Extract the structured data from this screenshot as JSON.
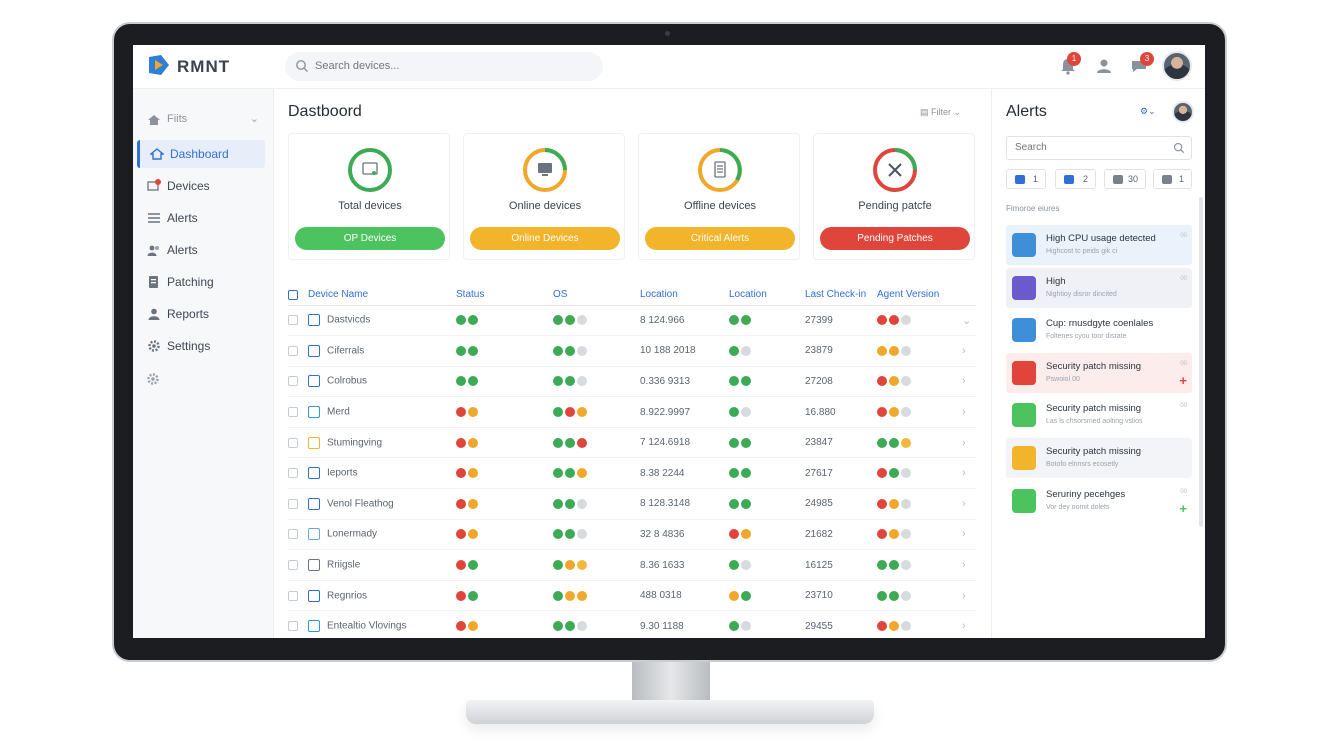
{
  "app": {
    "brand": "RMNT",
    "search_placeholder": "Search devices..."
  },
  "topbar": {
    "notifications_count": "1",
    "messages_count": "3"
  },
  "sidebar": {
    "filter_label": "Fiits",
    "items": [
      {
        "label": "Dashboard",
        "icon": "home-icon"
      },
      {
        "label": "Devices",
        "icon": "devices-icon"
      },
      {
        "label": "Alerts",
        "icon": "list-icon"
      },
      {
        "label": "Alerts",
        "icon": "users-icon"
      },
      {
        "label": "Patching",
        "icon": "patch-icon"
      },
      {
        "label": "Reports",
        "icon": "person-icon"
      },
      {
        "label": "Settings",
        "icon": "gear-icon"
      }
    ]
  },
  "main": {
    "title": "Dastboord",
    "filter_label": "Filter",
    "cards": [
      {
        "label": "Total devices",
        "button": "OP Devices",
        "color": "#4cc35f",
        "ring": "#3daa55",
        "icon": "monitor-icon"
      },
      {
        "label": "Online devices",
        "button": "Online Devices",
        "color": "#f2b42a",
        "ring": "#f0a72a",
        "icon": "monitor-icon"
      },
      {
        "label": "Offline devices",
        "button": "Critical Alerts",
        "color": "#f2b42a",
        "ring": "#f0a72a",
        "icon": "server-icon"
      },
      {
        "label": "Pending patcfe",
        "button": "Pending Patches",
        "color": "#e0453b",
        "ring": "#e0453b",
        "icon": "wrench-icon"
      }
    ],
    "table": {
      "headers": [
        "Device Name",
        "Status",
        "OS",
        "Location",
        "Location",
        "Last Check-in",
        "Agent Version"
      ],
      "rows": [
        {
          "name": "Dastvicds",
          "status": [
            "g",
            "g"
          ],
          "os": [
            "g",
            "g",
            "x"
          ],
          "location": "8 124.966",
          "loc2": [
            "g",
            "g"
          ],
          "checkin": "27399",
          "agent": [
            "r",
            "r",
            "x"
          ],
          "chevron": "⌄"
        },
        {
          "name": "Ciferrals",
          "status": [
            "g",
            "g"
          ],
          "os": [
            "g",
            "g",
            "x"
          ],
          "location": "10 188 2018",
          "loc2": [
            "g",
            "x"
          ],
          "checkin": "23879",
          "agent": [
            "o",
            "o",
            "x"
          ],
          "chevron": "›"
        },
        {
          "name": "Colrobus",
          "status": [
            "g",
            "g"
          ],
          "os": [
            "g",
            "g",
            "x"
          ],
          "location": "0.336 9313",
          "loc2": [
            "g",
            "g"
          ],
          "checkin": "27208",
          "agent": [
            "r",
            "o",
            "x"
          ],
          "chevron": "›"
        },
        {
          "name": "Merd",
          "status": [
            "r",
            "o"
          ],
          "os": [
            "g",
            "r",
            "o"
          ],
          "location": "8.922.9997",
          "loc2": [
            "g",
            "x"
          ],
          "checkin": "16.880",
          "agent": [
            "r",
            "o",
            "x"
          ],
          "chevron": "›"
        },
        {
          "name": "Stumingving",
          "status": [
            "r",
            "o"
          ],
          "os": [
            "g",
            "g",
            "r"
          ],
          "location": "7 124.6918",
          "loc2": [
            "g",
            "g"
          ],
          "checkin": "23847",
          "agent": [
            "g",
            "g",
            "y"
          ],
          "chevron": "›"
        },
        {
          "name": "Ieports",
          "status": [
            "r",
            "o"
          ],
          "os": [
            "g",
            "g",
            "o"
          ],
          "location": "8.38 2244",
          "loc2": [
            "g",
            "g"
          ],
          "checkin": "27617",
          "agent": [
            "r",
            "g",
            "x"
          ],
          "chevron": "›"
        },
        {
          "name": "Venol Fleathog",
          "status": [
            "r",
            "o"
          ],
          "os": [
            "g",
            "g",
            "x"
          ],
          "location": "8 128.3148",
          "loc2": [
            "g",
            "g"
          ],
          "checkin": "24985",
          "agent": [
            "r",
            "o",
            "x"
          ],
          "chevron": "›"
        },
        {
          "name": "Lonermady",
          "status": [
            "r",
            "o"
          ],
          "os": [
            "g",
            "g",
            "x"
          ],
          "location": "32 8 4836",
          "loc2": [
            "r",
            "o"
          ],
          "checkin": "21682",
          "agent": [
            "r",
            "o",
            "x"
          ],
          "chevron": "›"
        },
        {
          "name": "Rriigsle",
          "status": [
            "r",
            "g"
          ],
          "os": [
            "g",
            "o",
            "y"
          ],
          "location": "8.36 1633",
          "loc2": [
            "g",
            "x"
          ],
          "checkin": "16125",
          "agent": [
            "g",
            "g",
            "x"
          ],
          "chevron": "›"
        },
        {
          "name": "Regnrios",
          "status": [
            "r",
            "g"
          ],
          "os": [
            "g",
            "o",
            "o"
          ],
          "location": "488 0318",
          "loc2": [
            "o",
            "g"
          ],
          "checkin": "23710",
          "agent": [
            "g",
            "g",
            "x"
          ],
          "chevron": "›"
        },
        {
          "name": "Entealtio Vlovings",
          "status": [
            "r",
            "o"
          ],
          "os": [
            "g",
            "g",
            "x"
          ],
          "location": "9.30 1188",
          "loc2": [
            "g",
            "x"
          ],
          "checkin": "29455",
          "agent": [
            "r",
            "o",
            "x"
          ],
          "chevron": "›"
        }
      ]
    }
  },
  "alerts": {
    "title": "Alerts",
    "search_placeholder": "Search",
    "chips": [
      {
        "label": "1",
        "icon": "info-icon",
        "color": "#2f6fd6"
      },
      {
        "label": "2",
        "icon": "card-icon",
        "color": "#2f6fd6"
      },
      {
        "label": "30",
        "icon": "pencil-icon",
        "color": "#7a828c"
      },
      {
        "label": "1",
        "icon": "keyboard-icon",
        "color": "#7a828c"
      }
    ],
    "subhead": "Fimoroe eiures",
    "items": [
      {
        "title": "High CPU usage detected",
        "sub": "Highcost tc peids gik ci",
        "meta": "00",
        "icon_color": "#3d8fd8",
        "bg": "#eaf2fc",
        "plus": ""
      },
      {
        "title": "High",
        "sub": "Nightioy disror dincited",
        "meta": "00",
        "icon_color": "#6a5acd",
        "bg": "#f0f1f6",
        "plus": ""
      },
      {
        "title": "Cup: rnusdgyte coenlales",
        "sub": "Foltenes cyou toor disrate",
        "meta": "",
        "icon_color": "#3d8fd8",
        "bg": "#ffffff",
        "plus": ""
      },
      {
        "title": "Security patch missing",
        "sub": "Pswoiol 00",
        "meta": "00",
        "icon_color": "#e0453b",
        "bg": "#fdecec",
        "plus": "+"
      },
      {
        "title": "Security patch missing",
        "sub": "Las ls chsorsmed aolting vslios",
        "meta": "00",
        "icon_color": "#4cc35f",
        "bg": "#ffffff",
        "plus": ""
      },
      {
        "title": "Security patch missing",
        "sub": "Botofo elnnsrs ecosetly",
        "meta": "",
        "icon_color": "#f2b42a",
        "bg": "#f2f4f7",
        "plus": ""
      },
      {
        "title": "Seruriny pecehges",
        "sub": "Vor dey oomit dolets",
        "meta": "00",
        "icon_color": "#4cc35f",
        "bg": "#ffffff",
        "plus": "+"
      }
    ]
  },
  "colors": {
    "accent": "#2f6fd6",
    "green": "#3daa55",
    "orange": "#f0a72a",
    "red": "#e0453b",
    "gray": "#d7dbe0"
  }
}
